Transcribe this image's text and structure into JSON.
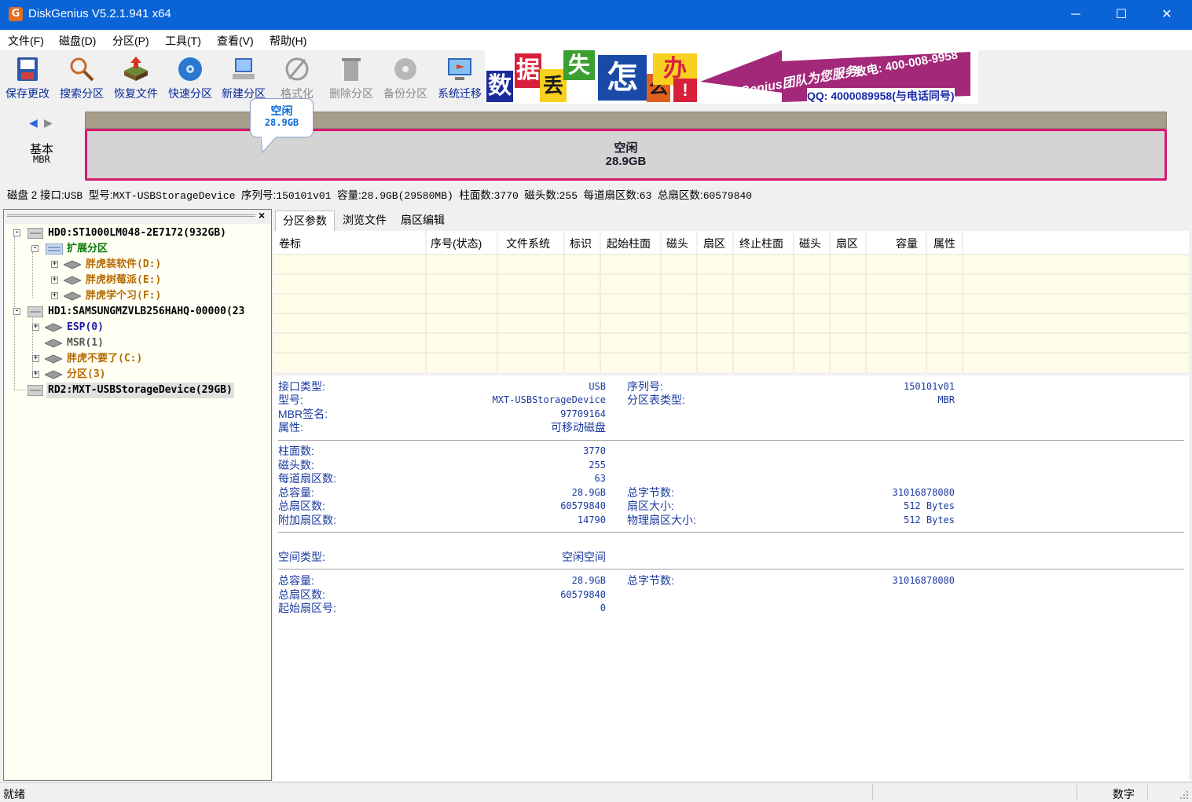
{
  "window": {
    "title": "DiskGenius V5.2.1.941 x64",
    "app_icon": "G",
    "minimize": "─",
    "maximize": "☐",
    "close": "✕"
  },
  "menu": [
    "文件(F)",
    "磁盘(D)",
    "分区(P)",
    "工具(T)",
    "查看(V)",
    "帮助(H)"
  ],
  "toolbar": [
    {
      "label": "保存更改",
      "icon": "save-changes-icon"
    },
    {
      "label": "搜索分区",
      "icon": "search-partition-icon"
    },
    {
      "label": "恢复文件",
      "icon": "recover-files-icon"
    },
    {
      "label": "快速分区",
      "icon": "quick-partition-icon"
    },
    {
      "label": "新建分区",
      "icon": "new-partition-icon"
    },
    {
      "label": "格式化",
      "icon": "format-icon"
    },
    {
      "label": "删除分区",
      "icon": "delete-partition-icon"
    },
    {
      "label": "备份分区",
      "icon": "backup-partition-icon"
    },
    {
      "label": "系统迁移",
      "icon": "system-migration-icon"
    }
  ],
  "ad": {
    "chars": [
      "数",
      "据",
      "丢",
      "失",
      "怎",
      "么",
      "办",
      "!"
    ],
    "brand": "DiskGenius团队为您服务!",
    "phone": "致电: 400-008-9958",
    "qq": "QQ: 4000089958(与电话同号)"
  },
  "diskmap": {
    "nav_prev": "◀",
    "nav_next": "▶",
    "type1": "基本",
    "type2": "MBR",
    "partition_label": "空闲",
    "partition_size": "28.9GB",
    "tooltip_label": "空闲",
    "tooltip_size": "28.9GB"
  },
  "disk_info": {
    "disk": "磁盘 2",
    "iface_label": "接口:",
    "iface": "USB",
    "model_label": "型号:",
    "model": "MXT-USBStorageDevice",
    "serial_label": "序列号:",
    "serial": "150101v01",
    "cap_label": "容量:",
    "cap": "28.9GB(29580MB)",
    "cyl_label": "柱面数:",
    "cyl": "3770",
    "heads_label": "磁头数:",
    "heads": "255",
    "spt_label": "每道扇区数:",
    "spt": "63",
    "total_label": "总扇区数:",
    "total": "60579840"
  },
  "tree": {
    "close": "×",
    "nodes": [
      {
        "label": "HD0:ST1000LM048-2E7172(932GB)",
        "color": "#000000"
      },
      {
        "label": "扩展分区",
        "color": "#0a7a0a"
      },
      {
        "label": "胖虎装软件(D:)",
        "color": "#b56a00"
      },
      {
        "label": "胖虎树莓派(E:)",
        "color": "#b56a00"
      },
      {
        "label": "胖虎学个习(F:)",
        "color": "#b56a00"
      },
      {
        "label": "HD1:SAMSUNGMZVLB256HAHQ-00000(23",
        "color": "#000000"
      },
      {
        "label": "ESP(0)",
        "color": "#1a1aa8"
      },
      {
        "label": "MSR(1)",
        "color": "#555555"
      },
      {
        "label": "胖虎不要了(C:)",
        "color": "#b56a00"
      },
      {
        "label": "分区(3)",
        "color": "#b56a00"
      },
      {
        "label": "RD2:MXT-USBStorageDevice(29GB)",
        "color": "#000000"
      }
    ]
  },
  "tabs": [
    "分区参数",
    "浏览文件",
    "扇区编辑"
  ],
  "table": {
    "headers": [
      "卷标",
      "序号(状态)",
      "文件系统",
      "标识",
      "起始柱面",
      "磁头",
      "扇区",
      "终止柱面",
      "磁头",
      "扇区",
      "容量",
      "属性"
    ]
  },
  "props": {
    "iface_type_label": "接口类型:",
    "iface_type": "USB",
    "model_label": "型号:",
    "model": "MXT-USBStorageDevice",
    "mbr_sig_label": "MBR签名:",
    "mbr_sig": "97709164",
    "attr_label": "属性:",
    "attr": "可移动磁盘",
    "serial_label": "序列号:",
    "serial": "150101v01",
    "pt_type_label": "分区表类型:",
    "pt_type": "MBR",
    "cyl_label": "柱面数:",
    "cyl": "3770",
    "heads_label": "磁头数:",
    "heads": "255",
    "spt_label": "每道扇区数:",
    "spt": "63",
    "total_cap_label": "总容量:",
    "total_cap": "28.9GB",
    "total_sec_label": "总扇区数:",
    "total_sec": "60579840",
    "extra_sec_label": "附加扇区数:",
    "extra_sec": "14790",
    "total_bytes_label": "总字节数:",
    "total_bytes": "31016878080",
    "sec_size_label": "扇区大小:",
    "sec_size": "512 Bytes",
    "phys_sec_label": "物理扇区大小:",
    "phys_sec": "512 Bytes",
    "space_type_label": "空间类型:",
    "space_type": "空闲空间",
    "f_total_cap_label": "总容量:",
    "f_total_cap": "28.9GB",
    "f_total_sec_label": "总扇区数:",
    "f_total_sec": "60579840",
    "f_start_sec_label": "起始扇区号:",
    "f_start_sec": "0",
    "f_total_bytes_label": "总字节数:",
    "f_total_bytes": "31016878080"
  },
  "status": {
    "left": "就绪",
    "right": "数字"
  }
}
